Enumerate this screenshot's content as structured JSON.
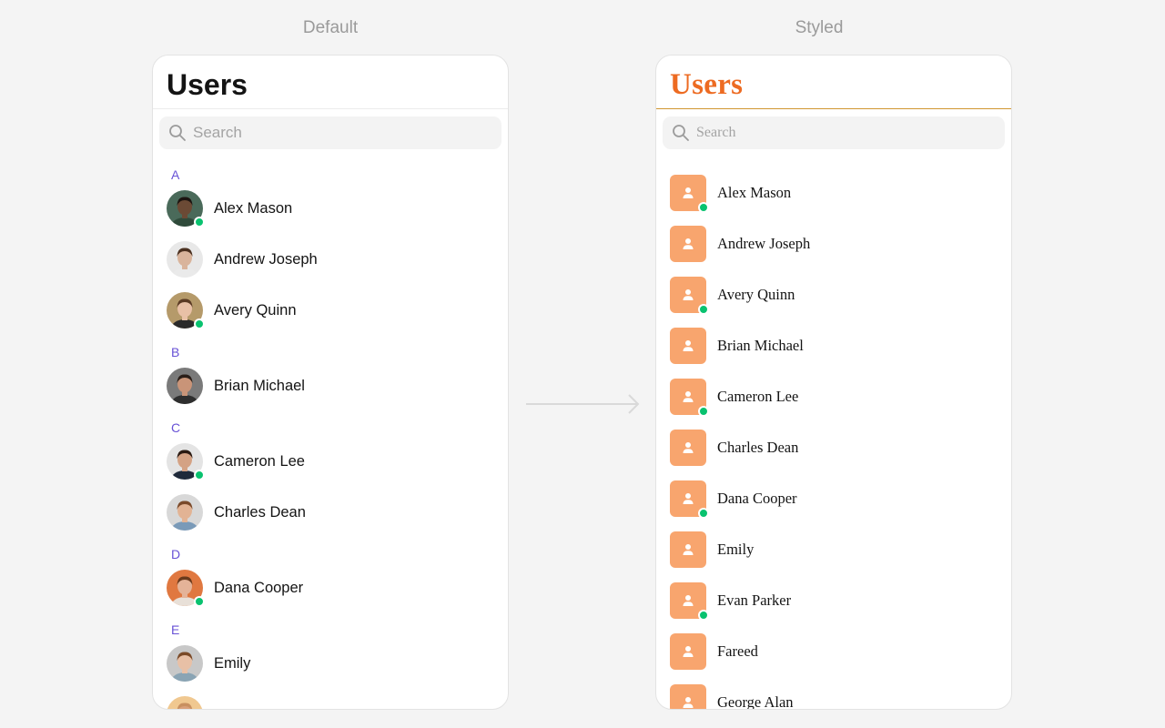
{
  "labels": {
    "default": "Default",
    "styled": "Styled"
  },
  "default_panel": {
    "title": "Users",
    "search_placeholder": "Search",
    "sections": [
      {
        "letter": "A",
        "users": [
          {
            "name": "Alex Mason",
            "online": true,
            "skin": "#6b4a35",
            "hair": "#1c1410",
            "shirt": "#2f4a3a",
            "bg": "#4a6a5a"
          },
          {
            "name": "Andrew Joseph",
            "online": false,
            "skin": "#d9b49c",
            "hair": "#4a3020",
            "shirt": "#eaeaea",
            "bg": "#e8e8e8"
          },
          {
            "name": "Avery Quinn",
            "online": true,
            "skin": "#e8c0a6",
            "hair": "#5a3a24",
            "shirt": "#2a2a2a",
            "bg": "#b59a6a"
          }
        ]
      },
      {
        "letter": "B",
        "users": [
          {
            "name": "Brian Michael",
            "online": false,
            "skin": "#c99478",
            "hair": "#2a1e18",
            "shirt": "#2e2e2e",
            "bg": "#7a7a7a"
          }
        ]
      },
      {
        "letter": "C",
        "users": [
          {
            "name": "Cameron Lee",
            "online": true,
            "skin": "#d4a284",
            "hair": "#2a1a12",
            "shirt": "#1f2a3a",
            "bg": "#e4e4e4"
          },
          {
            "name": "Charles Dean",
            "online": false,
            "skin": "#e2b394",
            "hair": "#7a4a2a",
            "shirt": "#7a9ab8",
            "bg": "#d8d8d8"
          }
        ]
      },
      {
        "letter": "D",
        "users": [
          {
            "name": "Dana Cooper",
            "online": true,
            "skin": "#e4b398",
            "hair": "#6a3a1c",
            "shirt": "#e8e0d8",
            "bg": "#e07840"
          }
        ]
      },
      {
        "letter": "E",
        "users": [
          {
            "name": "Emily",
            "online": false,
            "skin": "#e8c0a6",
            "hair": "#7a4a28",
            "shirt": "#8aa4b4",
            "bg": "#c8c8c8"
          },
          {
            "name": "",
            "online": false,
            "skin": "#d9a07a",
            "hair": "#c89060",
            "shirt": "#d0a070",
            "bg": "#f0c890"
          }
        ]
      }
    ]
  },
  "styled_panel": {
    "title": "Users",
    "search_placeholder": "Search",
    "avatar_color": "#f8a56e",
    "title_color": "#ed6b22",
    "users": [
      {
        "name": "Alex Mason",
        "online": true
      },
      {
        "name": "Andrew Joseph",
        "online": false
      },
      {
        "name": "Avery Quinn",
        "online": true
      },
      {
        "name": "Brian Michael",
        "online": false
      },
      {
        "name": "Cameron Lee",
        "online": true
      },
      {
        "name": "Charles Dean",
        "online": false
      },
      {
        "name": "Dana Cooper",
        "online": true
      },
      {
        "name": "Emily",
        "online": false
      },
      {
        "name": "Evan Parker",
        "online": true
      },
      {
        "name": "Fareed",
        "online": false
      },
      {
        "name": "George Alan",
        "online": false
      }
    ]
  },
  "icons": {
    "search": "search-icon",
    "arrow": "arrow-right-icon",
    "user_placeholder": "user-icon"
  },
  "colors": {
    "online": "#09c26f",
    "section_letter": "#6852d6",
    "styled_divider": "#d09630"
  }
}
